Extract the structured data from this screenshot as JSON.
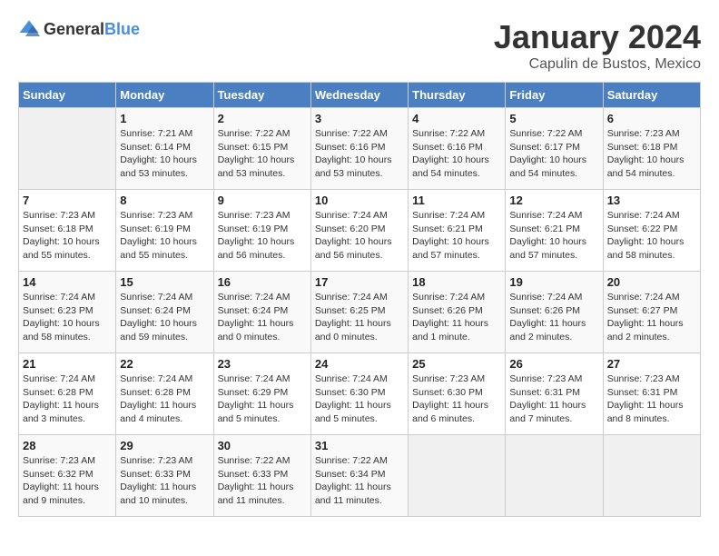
{
  "logo": {
    "general": "General",
    "blue": "Blue"
  },
  "title": "January 2024",
  "subtitle": "Capulin de Bustos, Mexico",
  "days_of_week": [
    "Sunday",
    "Monday",
    "Tuesday",
    "Wednesday",
    "Thursday",
    "Friday",
    "Saturday"
  ],
  "weeks": [
    [
      {
        "day": "",
        "info": ""
      },
      {
        "day": "1",
        "info": "Sunrise: 7:21 AM\nSunset: 6:14 PM\nDaylight: 10 hours\nand 53 minutes."
      },
      {
        "day": "2",
        "info": "Sunrise: 7:22 AM\nSunset: 6:15 PM\nDaylight: 10 hours\nand 53 minutes."
      },
      {
        "day": "3",
        "info": "Sunrise: 7:22 AM\nSunset: 6:16 PM\nDaylight: 10 hours\nand 53 minutes."
      },
      {
        "day": "4",
        "info": "Sunrise: 7:22 AM\nSunset: 6:16 PM\nDaylight: 10 hours\nand 54 minutes."
      },
      {
        "day": "5",
        "info": "Sunrise: 7:22 AM\nSunset: 6:17 PM\nDaylight: 10 hours\nand 54 minutes."
      },
      {
        "day": "6",
        "info": "Sunrise: 7:23 AM\nSunset: 6:18 PM\nDaylight: 10 hours\nand 54 minutes."
      }
    ],
    [
      {
        "day": "7",
        "info": "Sunrise: 7:23 AM\nSunset: 6:18 PM\nDaylight: 10 hours\nand 55 minutes."
      },
      {
        "day": "8",
        "info": "Sunrise: 7:23 AM\nSunset: 6:19 PM\nDaylight: 10 hours\nand 55 minutes."
      },
      {
        "day": "9",
        "info": "Sunrise: 7:23 AM\nSunset: 6:19 PM\nDaylight: 10 hours\nand 56 minutes."
      },
      {
        "day": "10",
        "info": "Sunrise: 7:24 AM\nSunset: 6:20 PM\nDaylight: 10 hours\nand 56 minutes."
      },
      {
        "day": "11",
        "info": "Sunrise: 7:24 AM\nSunset: 6:21 PM\nDaylight: 10 hours\nand 57 minutes."
      },
      {
        "day": "12",
        "info": "Sunrise: 7:24 AM\nSunset: 6:21 PM\nDaylight: 10 hours\nand 57 minutes."
      },
      {
        "day": "13",
        "info": "Sunrise: 7:24 AM\nSunset: 6:22 PM\nDaylight: 10 hours\nand 58 minutes."
      }
    ],
    [
      {
        "day": "14",
        "info": "Sunrise: 7:24 AM\nSunset: 6:23 PM\nDaylight: 10 hours\nand 58 minutes."
      },
      {
        "day": "15",
        "info": "Sunrise: 7:24 AM\nSunset: 6:24 PM\nDaylight: 10 hours\nand 59 minutes."
      },
      {
        "day": "16",
        "info": "Sunrise: 7:24 AM\nSunset: 6:24 PM\nDaylight: 11 hours\nand 0 minutes."
      },
      {
        "day": "17",
        "info": "Sunrise: 7:24 AM\nSunset: 6:25 PM\nDaylight: 11 hours\nand 0 minutes."
      },
      {
        "day": "18",
        "info": "Sunrise: 7:24 AM\nSunset: 6:26 PM\nDaylight: 11 hours\nand 1 minute."
      },
      {
        "day": "19",
        "info": "Sunrise: 7:24 AM\nSunset: 6:26 PM\nDaylight: 11 hours\nand 2 minutes."
      },
      {
        "day": "20",
        "info": "Sunrise: 7:24 AM\nSunset: 6:27 PM\nDaylight: 11 hours\nand 2 minutes."
      }
    ],
    [
      {
        "day": "21",
        "info": "Sunrise: 7:24 AM\nSunset: 6:28 PM\nDaylight: 11 hours\nand 3 minutes."
      },
      {
        "day": "22",
        "info": "Sunrise: 7:24 AM\nSunset: 6:28 PM\nDaylight: 11 hours\nand 4 minutes."
      },
      {
        "day": "23",
        "info": "Sunrise: 7:24 AM\nSunset: 6:29 PM\nDaylight: 11 hours\nand 5 minutes."
      },
      {
        "day": "24",
        "info": "Sunrise: 7:24 AM\nSunset: 6:30 PM\nDaylight: 11 hours\nand 5 minutes."
      },
      {
        "day": "25",
        "info": "Sunrise: 7:23 AM\nSunset: 6:30 PM\nDaylight: 11 hours\nand 6 minutes."
      },
      {
        "day": "26",
        "info": "Sunrise: 7:23 AM\nSunset: 6:31 PM\nDaylight: 11 hours\nand 7 minutes."
      },
      {
        "day": "27",
        "info": "Sunrise: 7:23 AM\nSunset: 6:31 PM\nDaylight: 11 hours\nand 8 minutes."
      }
    ],
    [
      {
        "day": "28",
        "info": "Sunrise: 7:23 AM\nSunset: 6:32 PM\nDaylight: 11 hours\nand 9 minutes."
      },
      {
        "day": "29",
        "info": "Sunrise: 7:23 AM\nSunset: 6:33 PM\nDaylight: 11 hours\nand 10 minutes."
      },
      {
        "day": "30",
        "info": "Sunrise: 7:22 AM\nSunset: 6:33 PM\nDaylight: 11 hours\nand 11 minutes."
      },
      {
        "day": "31",
        "info": "Sunrise: 7:22 AM\nSunset: 6:34 PM\nDaylight: 11 hours\nand 11 minutes."
      },
      {
        "day": "",
        "info": ""
      },
      {
        "day": "",
        "info": ""
      },
      {
        "day": "",
        "info": ""
      }
    ]
  ]
}
